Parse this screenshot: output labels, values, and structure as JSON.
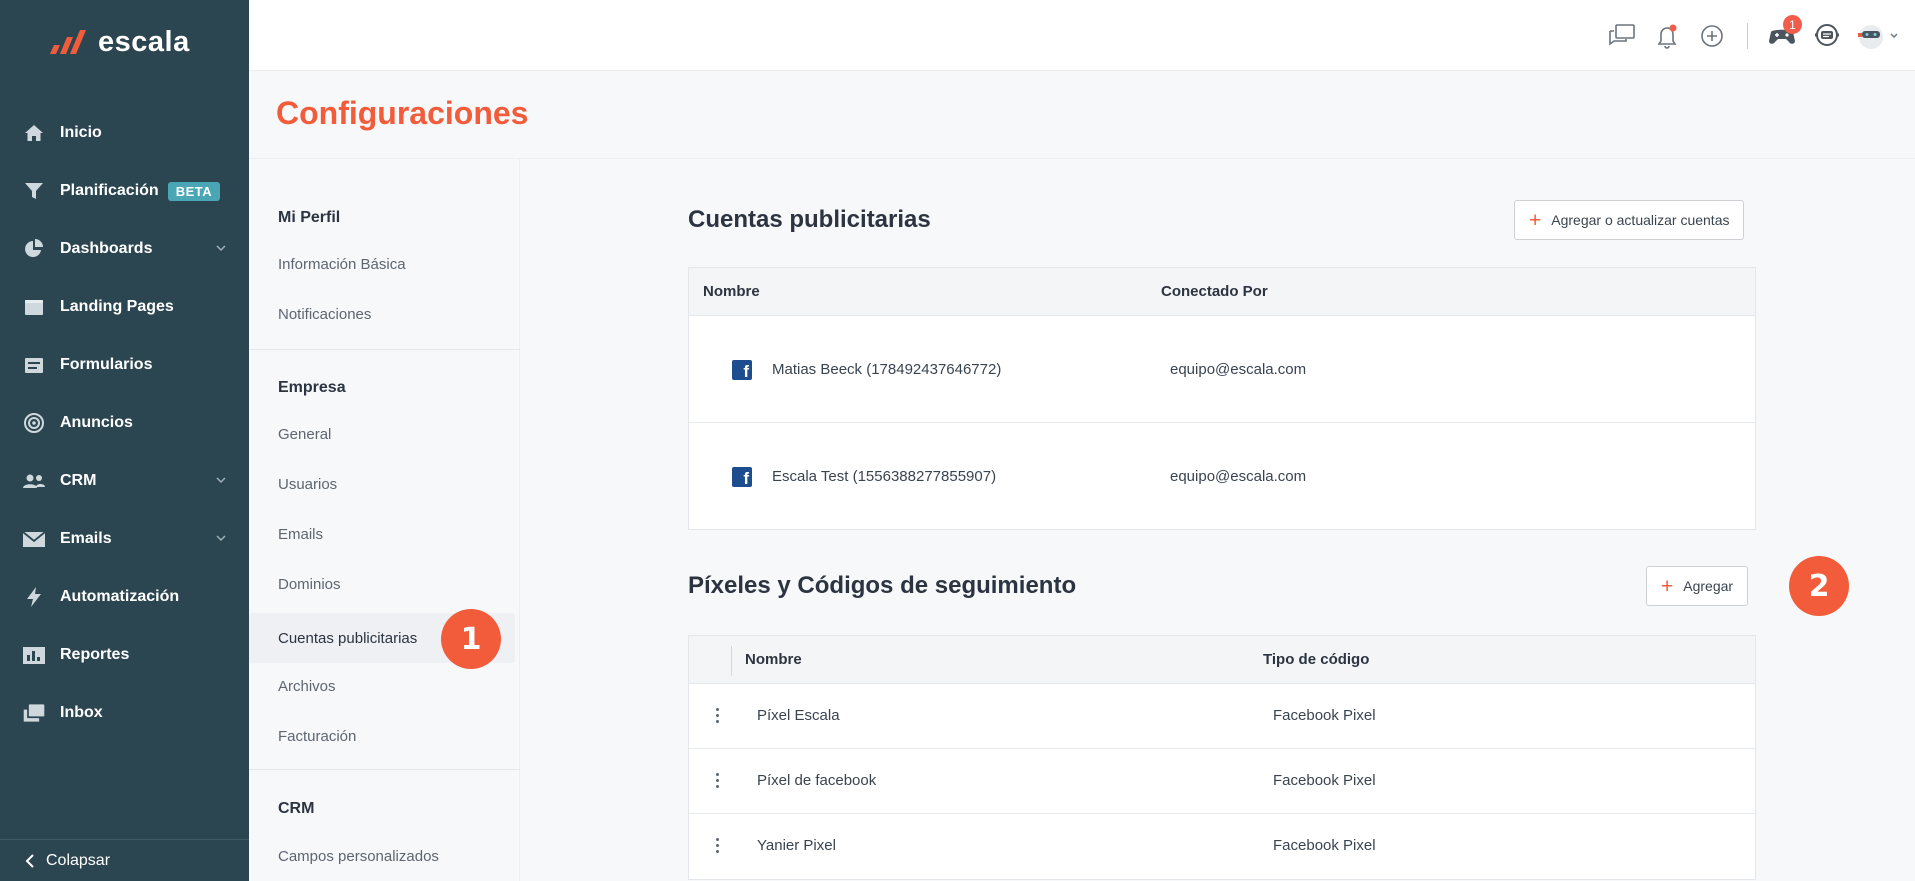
{
  "app": {
    "logo_text": "escala",
    "colors": {
      "sidebar_bg": "#2c4651",
      "accent": "#f25c3b",
      "facebook": "#1d4d8f",
      "beta_badge": "#4aa6b4"
    }
  },
  "sidebar": {
    "items": [
      {
        "label": "Inicio",
        "icon": "home-icon"
      },
      {
        "label": "Planificación",
        "icon": "funnel-icon",
        "badge": "BETA"
      },
      {
        "label": "Dashboards",
        "icon": "pie-chart-icon",
        "has_submenu": true
      },
      {
        "label": "Landing Pages",
        "icon": "landing-page-icon"
      },
      {
        "label": "Formularios",
        "icon": "form-icon"
      },
      {
        "label": "Anuncios",
        "icon": "target-icon"
      },
      {
        "label": "CRM",
        "icon": "users-icon",
        "has_submenu": true
      },
      {
        "label": "Emails",
        "icon": "envelope-icon",
        "has_submenu": true
      },
      {
        "label": "Automatización",
        "icon": "lightning-icon"
      },
      {
        "label": "Reportes",
        "icon": "bar-chart-icon"
      },
      {
        "label": "Inbox",
        "icon": "inbox-icon"
      }
    ],
    "collapse_label": "Colapsar"
  },
  "topbar": {
    "notification_count": "1",
    "icons": [
      "chat-bubbles-icon",
      "bell-icon",
      "plus-circle-icon",
      "game-icon",
      "support-chat-icon",
      "avatar-icon"
    ]
  },
  "page": {
    "title": "Configuraciones"
  },
  "settings_nav": {
    "sections": [
      {
        "title": "Mi Perfil",
        "items": [
          "Información Básica",
          "Notificaciones"
        ]
      },
      {
        "title": "Empresa",
        "items": [
          "General",
          "Usuarios",
          "Emails",
          "Dominios",
          "Cuentas publicitarias",
          "Archivos",
          "Facturación"
        ]
      },
      {
        "title": "CRM",
        "items": [
          "Campos personalizados"
        ]
      }
    ],
    "active_item": "Cuentas publicitarias"
  },
  "ad_accounts": {
    "title": "Cuentas publicitarias",
    "button_label": "Agregar o actualizar cuentas",
    "columns": [
      "Nombre",
      "Conectado Por"
    ],
    "rows": [
      {
        "name": "Matias Beeck (178492437646772)",
        "connected_by": "equipo@escala.com"
      },
      {
        "name": "Escala Test (1556388277855907)",
        "connected_by": "equipo@escala.com"
      }
    ]
  },
  "pixels": {
    "title": "Píxeles y Códigos de seguimiento",
    "button_label": "Agregar",
    "columns": [
      "Nombre",
      "Tipo de código"
    ],
    "rows": [
      {
        "name": "Píxel Escala",
        "type": "Facebook Pixel"
      },
      {
        "name": "Píxel de facebook",
        "type": "Facebook Pixel"
      },
      {
        "name": "Yanier Pixel",
        "type": "Facebook Pixel"
      }
    ]
  },
  "markers": [
    "1",
    "2"
  ]
}
